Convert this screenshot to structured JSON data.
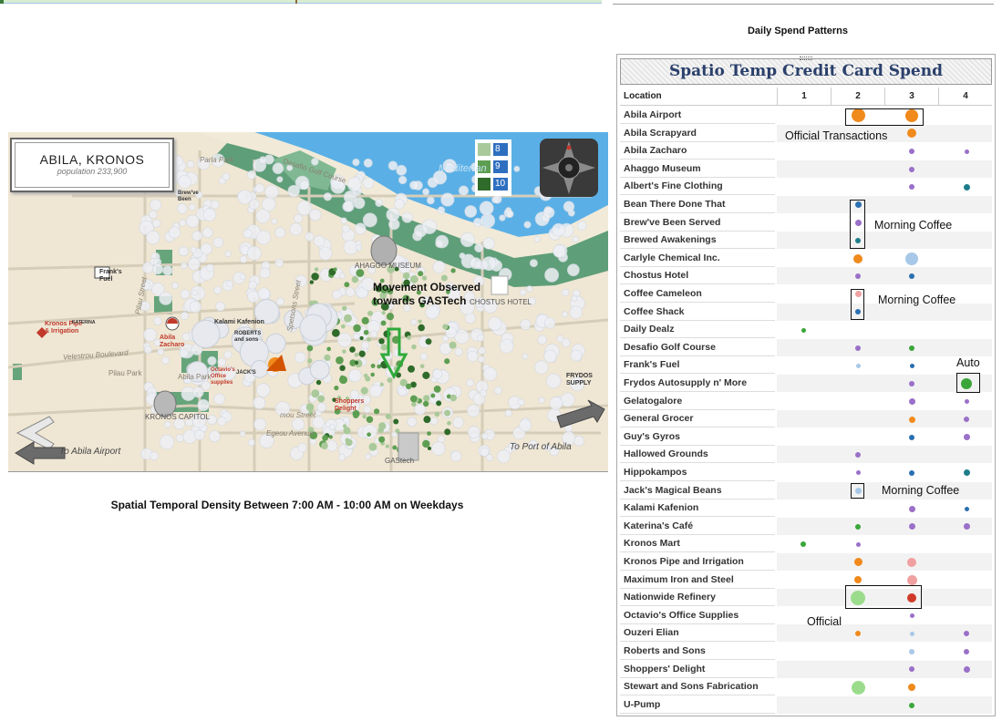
{
  "map": {
    "title": "ABILA, KRONOS",
    "population": "population 233,900",
    "legend": [
      {
        "label": "8",
        "color": "#a9c99a"
      },
      {
        "label": "9",
        "color": "#5e9e52"
      },
      {
        "label": "10",
        "color": "#2f6b2a"
      }
    ],
    "annotation": "Movement Observed\ntowards GASTech",
    "caption": "Spatial Temporal Density Between 7:00 AM - 10:00 AM on Weekdays",
    "labels": {
      "to_airport": "To Abila Airport",
      "to_port": "To Port of Abila",
      "mediterranean": "Mediterran",
      "golf": "Desafio Golf Course",
      "ahaggo": "AHAGGO MUSEUM",
      "chostus": "CHOSTUS HOTEL",
      "kronos_capitol": "KRONOS CAPITOL",
      "abila_park": "Abila Park",
      "pilau_park": "Pilau Park",
      "velestrou": "Velestrou Boulevard",
      "spetsons": "Spetsons Street",
      "pilau_street": "Pilau Street",
      "parla": "Parla Park",
      "mou_street": "mou Street",
      "egeou": "Egeou Avenue",
      "gastech": "GAStech",
      "kronos_pipe": "Kronos Pipe\n& Irrigation",
      "abila_zacharo": "Abila\nZacharo",
      "kalami": "Kalami Kafenion",
      "shoppers": "Shoppers\nDelight",
      "octavio": "Octavio's\nOffice\nsupplies",
      "franks": "Frank's\nFuel",
      "frydos": "FRYDOS\nSUPPLY",
      "brew": "Brew've\nBeen",
      "roberts": "ROBERTS\nand sons",
      "jacks": "JACK'S",
      "katerina": "KATERINA"
    }
  },
  "chart": {
    "caption": "Daily Spend Patterns",
    "title": "Spatio Temp Credit Card Spend",
    "header_location": "Location",
    "columns": [
      "1",
      "2",
      "3",
      "4"
    ],
    "locations": [
      "Abila Airport",
      "Abila Scrapyard",
      "Abila Zacharo",
      "Ahaggo Museum",
      "Albert's Fine Clothing",
      "Bean There Done That",
      "Brew've Been Served",
      "Brewed Awakenings",
      "Carlyle Chemical Inc.",
      "Chostus Hotel",
      "Coffee Cameleon",
      "Coffee Shack",
      "Daily Dealz",
      "Desafio Golf Course",
      "Frank's Fuel",
      "Frydos Autosupply n' More",
      "Gelatogalore",
      "General Grocer",
      "Guy's Gyros",
      "Hallowed Grounds",
      "Hippokampos",
      "Jack's Magical Beans",
      "Kalami Kafenion",
      "Katerina's Café",
      "Kronos Mart",
      "Kronos Pipe and Irrigation",
      "Maximum Iron and Steel",
      "Nationwide Refinery",
      "Octavio's Office Supplies",
      "Ouzeri Elian",
      "Roberts and Sons",
      "Shoppers' Delight",
      "Stewart and Sons Fabrication",
      "U-Pump"
    ],
    "annotations": {
      "official_transactions": "Official Transactions",
      "morning_coffee_1": "Morning Coffee",
      "morning_coffee_2": "Morning Coffee",
      "morning_coffee_3": "Morning Coffee",
      "auto": "Auto",
      "official": "Official"
    },
    "colors": {
      "orange": "#f08a1c",
      "blue": "#2a6fb0",
      "lightblue": "#a8c8e8",
      "green": "#3aa63a",
      "lightgreen": "#9bdc8c",
      "purple": "#9a70c8",
      "pink": "#f0a0a0",
      "red": "#d03a2a",
      "teal": "#1e7d8a"
    }
  }
}
